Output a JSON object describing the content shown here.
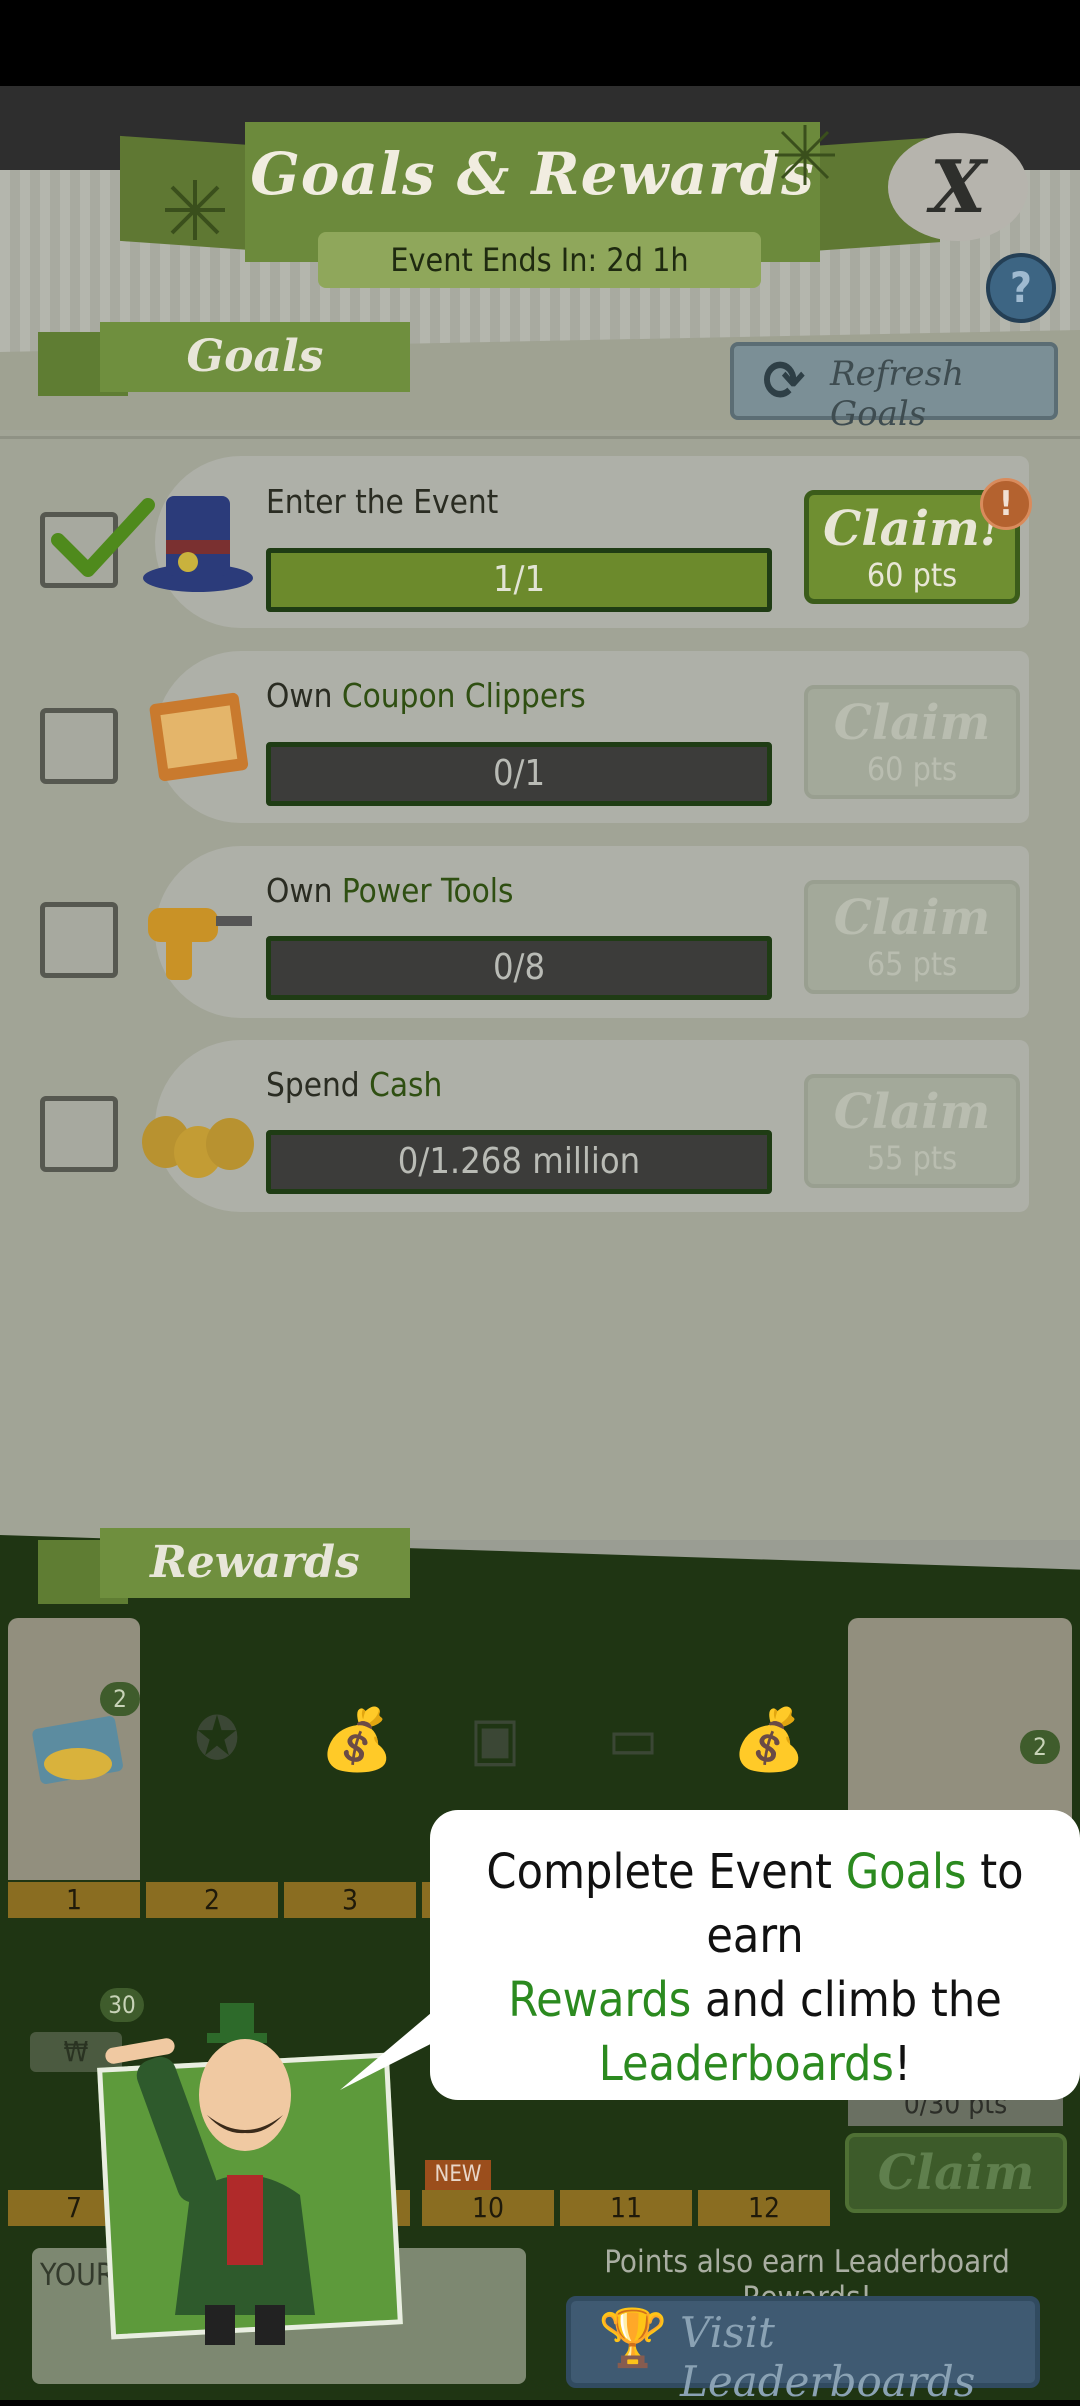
{
  "header": {
    "title": "Goals & Rewards",
    "event_ends": "Event Ends In: 2d 1h",
    "close_label": "X",
    "help_label": "?"
  },
  "goals_tab": {
    "label": "Goals"
  },
  "refresh": {
    "label": "Refresh Goals"
  },
  "goals": [
    {
      "name_prefix": "Enter the Event",
      "name_highlight": "",
      "progress_text": "1/1",
      "progress": 1.0,
      "checked": true,
      "claim_label": "Claim!",
      "claim_pts": "60 pts",
      "claim_active": true,
      "icon": "top-hat-icon"
    },
    {
      "name_prefix": "Own ",
      "name_highlight": "Coupon Clippers",
      "progress_text": "0/1",
      "progress": 0.0,
      "checked": false,
      "claim_label": "Claim",
      "claim_pts": "60 pts",
      "claim_active": false,
      "icon": "coupon-icon"
    },
    {
      "name_prefix": "Own ",
      "name_highlight": "Power Tools",
      "progress_text": "0/8",
      "progress": 0.0,
      "checked": false,
      "claim_label": "Claim",
      "claim_pts": "65 pts",
      "claim_active": false,
      "icon": "drill-icon"
    },
    {
      "name_prefix": "Spend ",
      "name_highlight": "Cash",
      "progress_text": "0/1.268 million",
      "progress": 0.0,
      "checked": false,
      "claim_label": "Claim",
      "claim_pts": "55 pts",
      "claim_active": false,
      "icon": "money-bags-icon"
    }
  ],
  "alert_badge": "!",
  "rewards_tab": {
    "label": "Rewards"
  },
  "rewards": {
    "row1_tiers": [
      "1",
      "2",
      "3"
    ],
    "row2_tiers": [
      "7",
      "10",
      "11",
      "12"
    ],
    "badge_count_1": "2",
    "badge_count_right": "2",
    "badge_count_row2": "30",
    "new_label": "NEW",
    "partial_pts": "0/30 pts",
    "claim_label": "Claim"
  },
  "tooltip": {
    "part1": "Complete Event ",
    "goals_word": "Goals",
    "part2": " to earn",
    "rewards_word": "Rewards",
    "part3": " and climb the",
    "leaderboards_word": "Leaderboards",
    "part4": "!"
  },
  "bottom": {
    "your_label": "YOUR",
    "note": "Points also earn Leaderboard Rewards!",
    "visit_label": "Visit Leaderboards"
  }
}
